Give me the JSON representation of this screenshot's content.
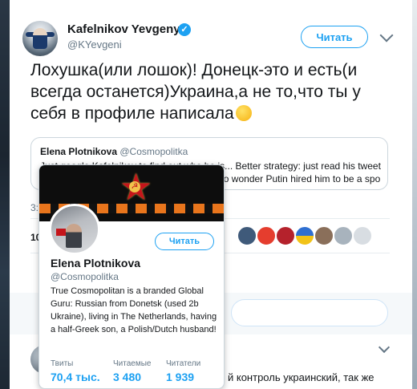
{
  "tweet": {
    "author_name": "Kafelnikov Yevgeny",
    "author_handle": "@KYevgeni",
    "follow_label": "Читать",
    "text": "Лохушка(или лошок)! Донецк-это и есть(и всегда останется)Украина,а не то,что ты у себя в профиле написала",
    "emoji": "winking-face-icon",
    "quote": {
      "author_name": "Elena Plotnikova",
      "author_handle": "@Cosmopolitka",
      "text_line1": "Just google Kafelnikov to find out who he is... Better strategy: just read his tweets to",
      "text_line2": "understand the level of his intelligence ... No wonder Putin hired him to be a sports ambassadeur u..."
    },
    "timestamp": "3:5",
    "retweet_count": "10"
  },
  "hovercard": {
    "name": "Elena Plotnikova",
    "handle": "@Cosmopolitka",
    "follow_label": "Читать",
    "bio": "True Cosmopolitan is a branded Global Guru: Russian from Donetsk (used 2b Ukraine), living in The Netherlands, having a half-Greek son, a Polish/Dutch husband!",
    "stats": [
      {
        "label": "Твиты",
        "value": "70,4 тыс."
      },
      {
        "label": "Читаемые",
        "value": "3 480"
      },
      {
        "label": "Читатели",
        "value": "1 939"
      }
    ]
  },
  "reply": {
    "text": "й контроль украинский, так же"
  },
  "colors": {
    "accent": "#1da1f2",
    "text": "#14171a",
    "secondary": "#657786",
    "border": "#ccd6dd"
  }
}
